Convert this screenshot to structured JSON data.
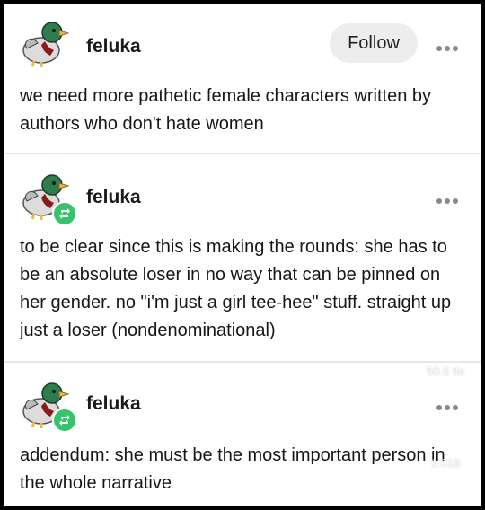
{
  "posts": [
    {
      "username": "feluka",
      "follow_label": "Follow",
      "text": "we need more pathetic female characters written by authors who don't hate women"
    },
    {
      "username": "feluka",
      "text": "to be clear since this is making the rounds: she has to be an absolute loser in no way that can be pinned on her gender. no \"i'm just a girl tee-hee\" stuff. straight up just a loser (nondenominational)"
    },
    {
      "username": "feluka",
      "text": "addendum: she must be the most important person in the whole narrative"
    }
  ],
  "overlay": {
    "likes": "50.6 tis",
    "comments": "1.018"
  },
  "icons": {
    "avatar": "duck-avatar-icon",
    "reblog": "reblog-icon",
    "more": "more-options-icon",
    "like": "heart-icon",
    "comment": "comment-icon",
    "share": "share-icon"
  },
  "colors": {
    "reblog_green": "#35c46a",
    "follow_bg": "#ededed",
    "background": "#ffffff"
  }
}
